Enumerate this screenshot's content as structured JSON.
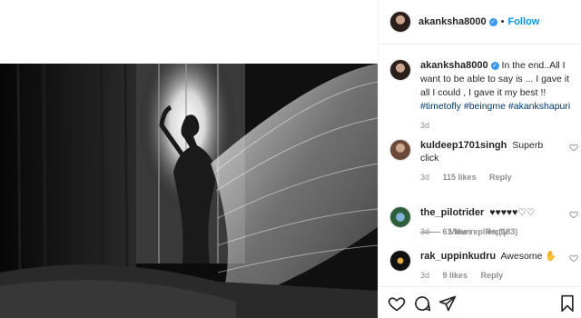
{
  "post": {
    "author": "akanksha8000",
    "follow_label": "Follow",
    "separator": "•",
    "verified_glyph": "✓"
  },
  "caption": {
    "author": "akanksha8000",
    "text": "In the end..All I want to be able to say is ... I gave it all I could , I gave it my best !!",
    "tags": [
      "#timetofly",
      "#beingme",
      "#akankshapuri"
    ],
    "age": "3d"
  },
  "comments": [
    {
      "user": "kuldeep1701singh",
      "text": "Superb click",
      "age": "3d",
      "likes": "115 likes",
      "reply_label": "Reply"
    },
    {
      "user": "the_pilotrider",
      "text": "♥♥♥♥♥♡♡",
      "age": "3d",
      "likes": "61 likes",
      "reply_label": "Reply"
    },
    {
      "user": "rak_uppinkudru",
      "text": "Awesome ✋",
      "age": "3d",
      "likes": "9 likes",
      "reply_label": "Reply"
    }
  ],
  "view_replies": "View replies (183)",
  "icons": {
    "like": "heart-icon",
    "comment": "comment-icon",
    "share": "share-icon",
    "save": "bookmark-icon",
    "verified": "verified-badge-icon"
  },
  "colors": {
    "accent": "#0095f6",
    "hashtag": "#00376b",
    "muted": "#8e8e8e",
    "text": "#262626",
    "border": "#efefef"
  }
}
